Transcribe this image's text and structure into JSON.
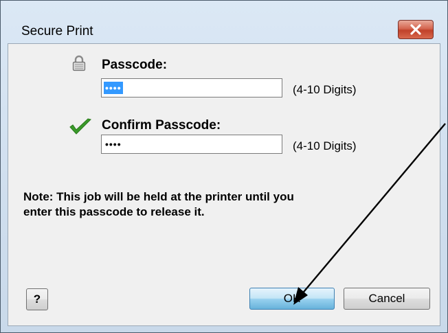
{
  "window": {
    "title": "Secure Print"
  },
  "passcode": {
    "label": "Passcode:",
    "masked_value": "••••",
    "hint": "(4-10 Digits)"
  },
  "confirm": {
    "label": "Confirm Passcode:",
    "masked_value": "••••",
    "hint": "(4-10 Digits)"
  },
  "note": "Note:  This job will be held at the printer until you\nenter this passcode to release it.",
  "buttons": {
    "help": "?",
    "ok": "OK",
    "cancel": "Cancel"
  },
  "icons": {
    "lock": "lock-icon",
    "check": "checkmark-icon",
    "close": "close-icon"
  },
  "colors": {
    "selection": "#3399ff",
    "check_green": "#3a9a2a",
    "close_red": "#c8452e"
  }
}
